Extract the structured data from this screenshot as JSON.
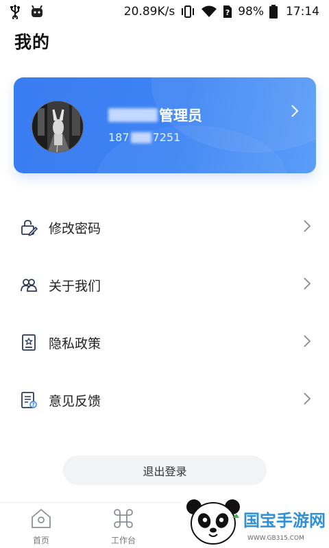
{
  "status_bar": {
    "net_speed": "20.89K/s",
    "battery": "98%",
    "time": "17:14",
    "icons": [
      "usb-icon",
      "android-icon",
      "vibrate-icon",
      "wifi-icon",
      "no-sim-icon",
      "battery-icon"
    ]
  },
  "page": {
    "title": "我的"
  },
  "profile": {
    "name_suffix": "管理员",
    "phone_prefix": "187",
    "phone_suffix": "7251"
  },
  "menu": {
    "items": [
      {
        "label": "修改密码",
        "icon": "lock-edit-icon"
      },
      {
        "label": "关于我们",
        "icon": "users-icon"
      },
      {
        "label": "隐私政策",
        "icon": "privacy-policy-icon"
      },
      {
        "label": "意见反馈",
        "icon": "feedback-icon"
      }
    ]
  },
  "logout": {
    "label": "退出登录"
  },
  "tab_bar": {
    "tabs": [
      {
        "label": "首页",
        "icon": "home-icon"
      },
      {
        "label": "工作台",
        "icon": "workbench-icon"
      }
    ]
  },
  "watermark": {
    "text": "国宝手游网",
    "url": "WWW.GB315.COM"
  },
  "colors": {
    "accent": "#3a7cf2",
    "text": "#222222",
    "muted": "#777777",
    "button_bg": "#f2f3f5"
  }
}
